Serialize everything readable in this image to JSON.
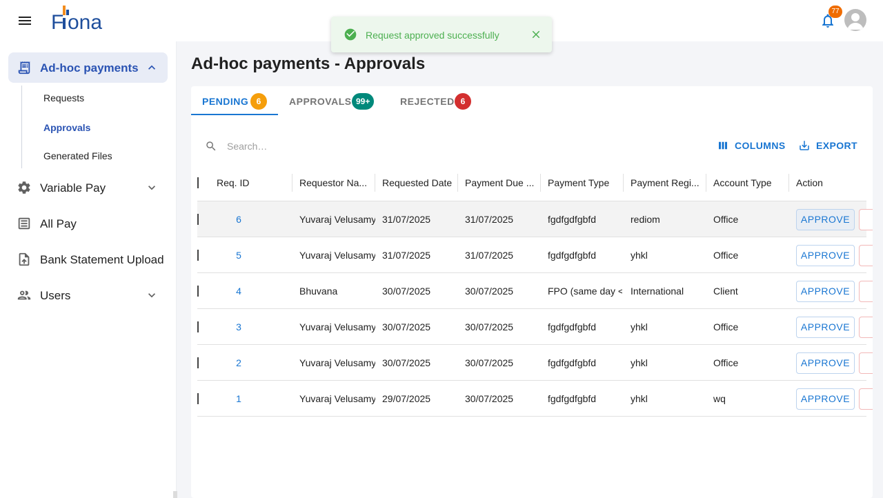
{
  "header": {
    "logo_text": "Fiona",
    "notification_count": "77"
  },
  "sidebar": {
    "items": [
      {
        "label": "Ad-hoc payments",
        "icon": "receipt-icon"
      },
      {
        "label": "Variable Pay",
        "icon": "gear-icon"
      },
      {
        "label": "All Pay",
        "icon": "list-icon"
      },
      {
        "label": "Bank Statement Upload",
        "icon": "upload-file-icon"
      },
      {
        "label": "Users",
        "icon": "users-icon"
      }
    ],
    "sub_items": [
      "Requests",
      "Approvals",
      "Generated Files"
    ]
  },
  "toast": {
    "message": "Request approved successfully"
  },
  "main": {
    "title": "Ad-hoc payments - Approvals",
    "tabs": [
      {
        "label": "PENDING",
        "badge": "6",
        "badge_color": "#f59e0b"
      },
      {
        "label": "APPROVALS",
        "badge": "99+",
        "badge_color": "#00897b"
      },
      {
        "label": "REJECTED",
        "badge": "6",
        "badge_color": "#d32f2f"
      }
    ],
    "search_placeholder": "Search…",
    "columns_label": "COLUMNS",
    "export_label": "EXPORT"
  },
  "table": {
    "headers": [
      "Req. ID",
      "Requestor Na...",
      "Requested Date",
      "Payment Due ...",
      "Payment Type",
      "Payment Regi...",
      "Account Type",
      "Action"
    ],
    "rows": [
      [
        "6",
        "Yuvaraj Velusamy",
        "31/07/2025",
        "31/07/2025",
        "fgdfgdfgbfd",
        "rediom",
        "Office"
      ],
      [
        "5",
        "Yuvaraj Velusamy",
        "31/07/2025",
        "31/07/2025",
        "fgdfgdfgbfd",
        "yhkl",
        "Office"
      ],
      [
        "4",
        "Bhuvana",
        "30/07/2025",
        "30/07/2025",
        "FPO (same day <",
        "International",
        "Client"
      ],
      [
        "3",
        "Yuvaraj Velusamy",
        "30/07/2025",
        "30/07/2025",
        "fgdfgdfgbfd",
        "yhkl",
        "Office"
      ],
      [
        "2",
        "Yuvaraj Velusamy",
        "30/07/2025",
        "30/07/2025",
        "fgdfgdfgbfd",
        "yhkl",
        "Office"
      ],
      [
        "1",
        "Yuvaraj Velusamy",
        "29/07/2025",
        "30/07/2025",
        "fgdfgdfgbfd",
        "yhkl",
        "wq"
      ]
    ],
    "approve_label": "APPROVE"
  },
  "colors": {
    "primary": "#1976d2",
    "nav_active": "#2a53b3",
    "toast_green": "#4caf50"
  }
}
